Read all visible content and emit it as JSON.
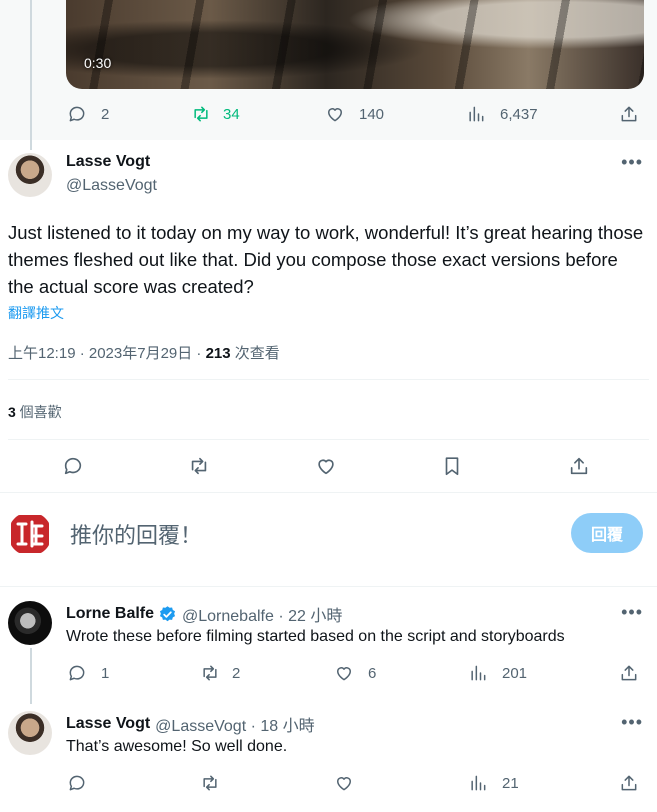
{
  "video": {
    "timestamp": "0:30"
  },
  "top_actions": {
    "replies": "2",
    "reposts": "34",
    "likes": "140",
    "views": "6,437"
  },
  "main_tweet": {
    "author_name": "Lasse Vogt",
    "handle": "@LasseVogt",
    "text": "Just listened to it today on my way to work, wonderful! It’s great hearing those themes fleshed out like that. Did you compose those exact versions before the actual score was created?",
    "translate_label": "翻譯推文",
    "time": "上午12:19 · 2023年7月29日 · ",
    "views_count": "213",
    "views_label": " 次查看",
    "likes_count": "3",
    "likes_label": " 個喜歡"
  },
  "composer": {
    "placeholder": "推你的回覆！",
    "reply_button": "回覆"
  },
  "replies": [
    {
      "author_name": "Lorne Balfe",
      "verified": true,
      "handle_time": "@Lornebalfe · 22 小時",
      "text": "Wrote these before filming started based on the script and storyboards",
      "replies": "1",
      "reposts": "2",
      "likes": "6",
      "views": "201"
    },
    {
      "author_name": "Lasse Vogt",
      "verified": false,
      "handle_time": "@LasseVogt · 18 小時",
      "text": "That’s awesome! So well done.",
      "replies": "",
      "reposts": "",
      "likes": "",
      "views": "21"
    }
  ],
  "colors": {
    "accent": "#1d9bf0",
    "repost_active": "#00ba7c",
    "reply_button_disabled": "#8ecdf8",
    "text_secondary": "#536471",
    "divider": "#eff3f4"
  },
  "icons": [
    "reply-icon",
    "repost-icon",
    "like-icon",
    "views-icon",
    "share-icon",
    "bookmark-icon",
    "more-icon",
    "verified-icon"
  ]
}
